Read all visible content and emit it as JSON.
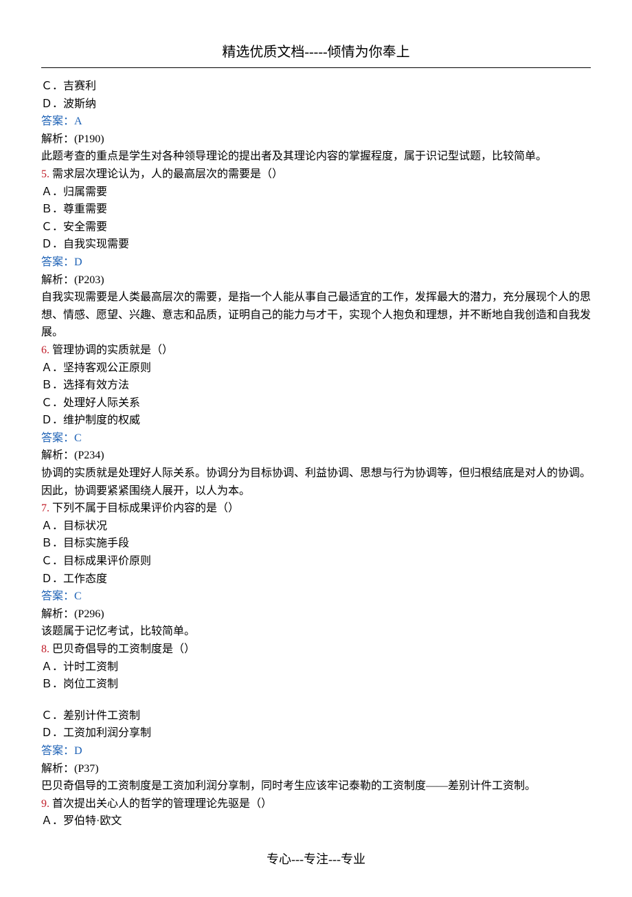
{
  "header": {
    "title": "精选优质文档-----倾情为你奉上"
  },
  "lines": {
    "l1": "Ｃ．吉赛利",
    "l2": "Ｄ．波斯纳",
    "l3": "答案：A",
    "l4": "解析：(P190)",
    "l5": "此题考查的重点是学生对各种领导理论的提出者及其理论内容的掌握程度，属于识记型试题，比较简单。",
    "q5num": "5.",
    "q5text": " 需求层次理论认为，人的最高层次的需要是（）",
    "l7": "Ａ．归属需要",
    "l8": "Ｂ．尊重需要",
    "l9": "Ｃ．安全需要",
    "l10": "Ｄ．自我实现需要",
    "l11": "答案：D",
    "l12": "解析：(P203)",
    "l13": "自我实现需要是人类最高层次的需要，是指一个人能从事自己最适宜的工作，发挥最大的潜力，充分展现个人的思想、情感、愿望、兴趣、意志和品质，证明自己的能力与才干，实现个人抱负和理想，并不断地自我创造和自我发展。",
    "q6num": "6.",
    "q6text": " 管理协调的实质就是（）",
    "l15": "Ａ．坚持客观公正原则",
    "l16": "Ｂ．选择有效方法",
    "l17": "Ｃ．处理好人际关系",
    "l18": "Ｄ．维护制度的权威",
    "l19": "答案：C",
    "l20": "解析：(P234)",
    "l21": "协调的实质就是处理好人际关系。协调分为目标协调、利益协调、思想与行为协调等，但归根结底是对人的协调。因此，协调要紧紧围绕人展开，以人为本。",
    "q7num": "7.",
    "q7text": " 下列不属于目标成果评价内容的是（）",
    "l23": "Ａ．目标状况",
    "l24": "Ｂ．目标实施手段",
    "l25": "Ｃ．目标成果评价原则",
    "l26": "Ｄ．工作态度",
    "l27": "答案：C",
    "l28": "解析：(P296)",
    "l29": "该题属于记忆考试，比较简单。",
    "q8num": "8.",
    "q8text": " 巴贝奇倡导的工资制度是（）",
    "l31": "Ａ．计时工资制",
    "l32": "Ｂ．岗位工资制",
    "l33": "Ｃ．差别计件工资制",
    "l34": "Ｄ．工资加利润分享制",
    "l35": "答案：D",
    "l36": "解析：(P37)",
    "l37": "巴贝奇倡导的工资制度是工资加利润分享制，同时考生应该牢记泰勒的工资制度——差别计件工资制。",
    "q9num": "9.",
    "q9text": " 首次提出关心人的哲学的管理理论先驱是（）",
    "l39": "Ａ．罗伯特·欧文"
  },
  "footer": {
    "text": "专心---专注---专业"
  }
}
